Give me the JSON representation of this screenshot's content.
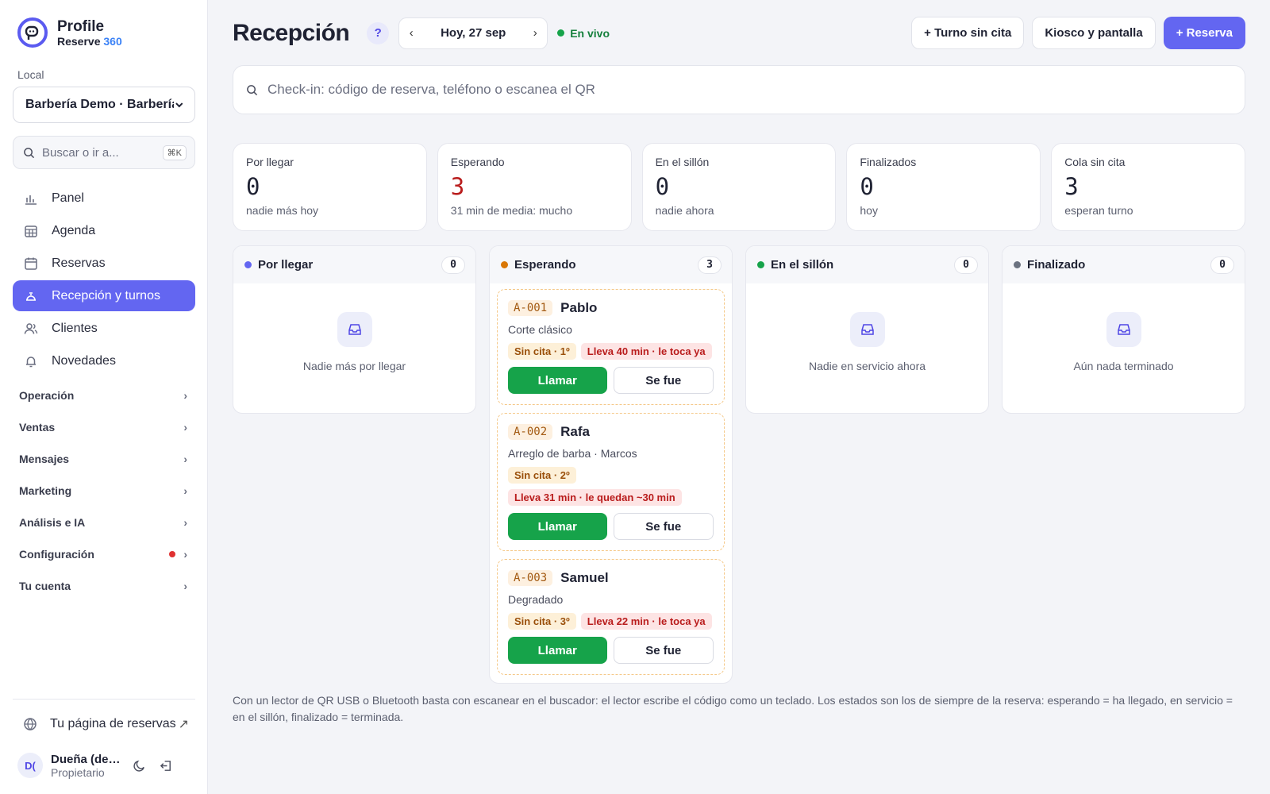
{
  "brand": {
    "title": "Profile",
    "sub_prefix": "Reserve",
    "sub_accent": "360"
  },
  "local": {
    "label": "Local",
    "value": "Barbería Demo · Barbería"
  },
  "side_search": {
    "placeholder": "Buscar o ir a...",
    "shortcut": "⌘K"
  },
  "nav": [
    {
      "label": "Panel",
      "icon": "bar-chart-icon"
    },
    {
      "label": "Agenda",
      "icon": "calendar-grid-icon"
    },
    {
      "label": "Reservas",
      "icon": "calendar-icon"
    },
    {
      "label": "Recepción y turnos",
      "icon": "reception-bell-icon",
      "active": true
    },
    {
      "label": "Clientes",
      "icon": "users-icon"
    },
    {
      "label": "Novedades",
      "icon": "bell-icon"
    }
  ],
  "groups": [
    "Operación",
    "Ventas",
    "Mensajes",
    "Marketing",
    "Análisis e IA",
    "Configuración",
    "Tu cuenta"
  ],
  "booking_page_link": "Tu página de reservas",
  "user": {
    "initials": "D(",
    "name": "Dueña (demo)",
    "role": "Propietario"
  },
  "header": {
    "title": "Recepción",
    "help": "?",
    "date": "Hoy, 27 sep",
    "live": "En vivo",
    "btn_walkin": "+ Turno sin cita",
    "btn_kiosk": "Kiosco y pantalla",
    "btn_reserve": "+ Reserva"
  },
  "checkin_placeholder": "Check-in: código de reserva, teléfono o escanea el QR",
  "stats": [
    {
      "label": "Por llegar",
      "value": "0",
      "sub": "nadie más hoy"
    },
    {
      "label": "Esperando",
      "value": "3",
      "sub": "31 min de media: mucho"
    },
    {
      "label": "En el sillón",
      "value": "0",
      "sub": "nadie ahora"
    },
    {
      "label": "Finalizados",
      "value": "0",
      "sub": "hoy"
    },
    {
      "label": "Cola sin cita",
      "value": "3",
      "sub": "esperan turno"
    }
  ],
  "columns": [
    {
      "title": "Por llegar",
      "count": "0",
      "color": "#6366f1",
      "empty": "Nadie más por llegar"
    },
    {
      "title": "Esperando",
      "count": "3",
      "color": "#d97706"
    },
    {
      "title": "En el sillón",
      "count": "0",
      "color": "#16a34a",
      "empty": "Nadie en servicio ahora"
    },
    {
      "title": "Finalizado",
      "count": "0",
      "color": "#6b7280",
      "empty": "Aún nada terminado"
    }
  ],
  "waiting": [
    {
      "code": "A-001",
      "name": "Pablo",
      "service": "Corte clásico",
      "badge_queue": "Sin cita · 1º",
      "badge_time": "Lleva 40 min · le toca ya"
    },
    {
      "code": "A-002",
      "name": "Rafa",
      "service": "Arreglo de barba · Marcos",
      "badge_queue": "Sin cita · 2º",
      "badge_time": "Lleva 31 min · le quedan ~30 min"
    },
    {
      "code": "A-003",
      "name": "Samuel",
      "service": "Degradado",
      "badge_queue": "Sin cita · 3º",
      "badge_time": "Lleva 22 min · le toca ya"
    }
  ],
  "card_actions": {
    "call": "Llamar",
    "left": "Se fue"
  },
  "footnote": "Con un lector de QR USB o Bluetooth basta con escanear en el buscador: el lector escribe el código como un teclado. Los estados son los de siempre de la reserva: esperando = ha llegado, en servicio = en el sillón, finalizado = terminada.",
  "colors": {
    "accent": "#6366f1",
    "success": "#16a34a",
    "danger": "#b91c1c",
    "warning": "#d97706"
  }
}
